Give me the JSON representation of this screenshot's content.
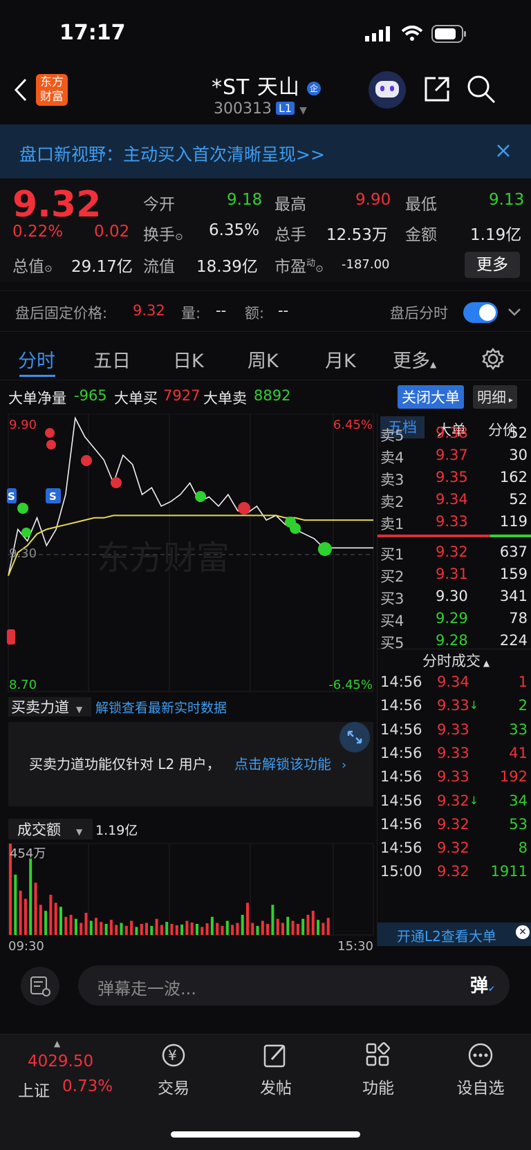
{
  "status_bar": {
    "time": "17:17"
  },
  "header": {
    "logo_text_1": "东方",
    "logo_text_2": "财富",
    "title": "*ST 天山",
    "title_badge": "企",
    "code": "300313",
    "level_badge": "L1"
  },
  "banner": {
    "text": "盘口新视野：主动买入首次清晰呈现>>"
  },
  "quote": {
    "price": "9.32",
    "change_pct": "0.22%",
    "change": "0.02",
    "open_label": "今开",
    "open": "9.18",
    "high_label": "最高",
    "high": "9.90",
    "low_label": "最低",
    "low": "9.13",
    "turnover_label": "换手",
    "turnover": "6.35%",
    "volume_label": "总手",
    "volume": "12.53万",
    "amount_label": "金额",
    "amount": "1.19亿",
    "mktcap_label": "总值",
    "mktcap": "29.17亿",
    "float_label": "流值",
    "float": "18.39亿",
    "pe_label": "市盈",
    "pe_sup": "动",
    "pe": "-187.00",
    "more_label": "更多"
  },
  "after_hours": {
    "label": "盘后固定价格:",
    "price": "9.32",
    "vol_label": "量:",
    "vol": "--",
    "amt_label": "额:",
    "amt": "--",
    "toggle_label": "盘后分时"
  },
  "tabs": [
    "分时",
    "五日",
    "日K",
    "周K",
    "月K",
    "更多"
  ],
  "big_orders": {
    "net_label": "大单净量",
    "net": "-965",
    "buy_label": "大单买",
    "buy": "7927",
    "sell_label": "大单卖",
    "sell": "8892",
    "close_btn": "关闭大单",
    "detail_btn": "明细"
  },
  "chart_labels": {
    "price_top": "9.90",
    "price_mid": "9.30",
    "price_bottom": "8.70",
    "pct_top": "6.45%",
    "pct_bottom": "-6.45%",
    "watermark": "东方财富",
    "force_title": "买卖力道",
    "force_unlock": "解锁查看最新实时数据",
    "force_msg": "买卖力道功能仅针对 L2 用户，",
    "force_link": "点击解锁该功能",
    "vol_title": "成交额",
    "vol_total": "1.19亿",
    "vol_max": "454万",
    "time_start": "09:30",
    "time_end": "15:30"
  },
  "chart_data": {
    "type": "line",
    "x_range": [
      "09:30",
      "15:00"
    ],
    "ylim": [
      8.7,
      9.9
    ],
    "prev_close": 9.3,
    "series": [
      {
        "values": [
          9.2,
          9.4,
          9.35,
          9.45,
          9.33,
          9.4,
          9.55,
          9.88,
          9.8,
          9.75,
          9.7,
          9.6,
          9.72,
          9.68,
          9.55,
          9.58,
          9.5,
          9.52,
          9.55,
          9.6,
          9.52,
          9.54,
          9.5,
          9.55,
          9.48,
          9.47,
          9.5,
          9.44,
          9.46,
          9.42,
          9.4,
          9.38,
          9.36,
          9.32,
          9.32
        ]
      },
      {
        "values": [
          9.2,
          9.3,
          9.33,
          9.38,
          9.4,
          9.41,
          9.42,
          9.43,
          9.44,
          9.45,
          9.45,
          9.46,
          9.46,
          9.46,
          9.46,
          9.46,
          9.46,
          9.46,
          9.46,
          9.46,
          9.46,
          9.46,
          9.46,
          9.46,
          9.46,
          9.46,
          9.46,
          9.46,
          9.46,
          9.45,
          9.45,
          9.44,
          9.44,
          9.44,
          9.44
        ]
      }
    ]
  },
  "volume_data": {
    "ylim": [
      0,
      454
    ],
    "values": [
      454,
      300,
      220,
      180,
      380,
      260,
      150,
      120,
      200,
      160,
      140,
      90,
      100,
      80,
      60,
      110,
      70,
      85,
      65,
      55,
      75,
      50,
      60,
      45,
      70,
      40,
      55,
      60,
      45,
      80,
      50,
      65,
      55,
      48,
      52,
      70,
      62,
      55,
      40,
      58,
      90,
      60,
      45,
      70,
      50,
      60,
      100,
      160,
      60,
      45,
      70,
      55,
      150,
      80,
      60,
      90,
      70,
      55,
      80,
      100,
      120,
      75,
      60,
      85
    ]
  },
  "order_book": {
    "tabs": [
      "五档",
      "大单",
      "分价"
    ],
    "asks": [
      {
        "label": "卖5",
        "price": "9.38",
        "vol": "52",
        "color": "#f2303a"
      },
      {
        "label": "卖4",
        "price": "9.37",
        "vol": "30",
        "color": "#f2303a"
      },
      {
        "label": "卖3",
        "price": "9.35",
        "vol": "162",
        "color": "#f2303a"
      },
      {
        "label": "卖2",
        "price": "9.34",
        "vol": "52",
        "color": "#f2303a"
      },
      {
        "label": "卖1",
        "price": "9.33",
        "vol": "119",
        "color": "#f2303a"
      }
    ],
    "bids": [
      {
        "label": "买1",
        "price": "9.32",
        "vol": "637",
        "color": "#f2303a"
      },
      {
        "label": "买2",
        "price": "9.31",
        "vol": "159",
        "color": "#f2303a"
      },
      {
        "label": "买3",
        "price": "9.30",
        "vol": "341",
        "color": "#e8e8e8"
      },
      {
        "label": "买4",
        "price": "9.29",
        "vol": "78",
        "color": "#2fd12f"
      },
      {
        "label": "买5",
        "price": "9.28",
        "vol": "224",
        "color": "#2fd12f"
      }
    ]
  },
  "ticks": {
    "title": "分时成交",
    "rows": [
      {
        "time": "14:56",
        "price": "9.34",
        "arrow": "",
        "vol": "1",
        "vol_color": "#f2303a"
      },
      {
        "time": "14:56",
        "price": "9.33",
        "arrow": "↓",
        "vol": "2",
        "vol_color": "#2fd12f"
      },
      {
        "time": "14:56",
        "price": "9.33",
        "arrow": "",
        "vol": "33",
        "vol_color": "#2fd12f"
      },
      {
        "time": "14:56",
        "price": "9.33",
        "arrow": "",
        "vol": "41",
        "vol_color": "#f2303a"
      },
      {
        "time": "14:56",
        "price": "9.33",
        "arrow": "",
        "vol": "192",
        "vol_color": "#f2303a"
      },
      {
        "time": "14:56",
        "price": "9.32",
        "arrow": "↓",
        "vol": "34",
        "vol_color": "#2fd12f"
      },
      {
        "time": "14:56",
        "price": "9.32",
        "arrow": "",
        "vol": "53",
        "vol_color": "#2fd12f"
      },
      {
        "time": "14:56",
        "price": "9.32",
        "arrow": "",
        "vol": "8",
        "vol_color": "#2fd12f"
      },
      {
        "time": "15:00",
        "price": "9.32",
        "arrow": "",
        "vol": "1911",
        "vol_color": "#2fd12f"
      }
    ],
    "l2_banner": "开通L2查看大单"
  },
  "input": {
    "placeholder": "弹幕走一波...",
    "send_label": "弹"
  },
  "nav": {
    "index_value": "4029.50",
    "index_name": "上证",
    "index_change": "0.73%",
    "items": [
      "交易",
      "发帖",
      "功能",
      "设自选"
    ]
  }
}
